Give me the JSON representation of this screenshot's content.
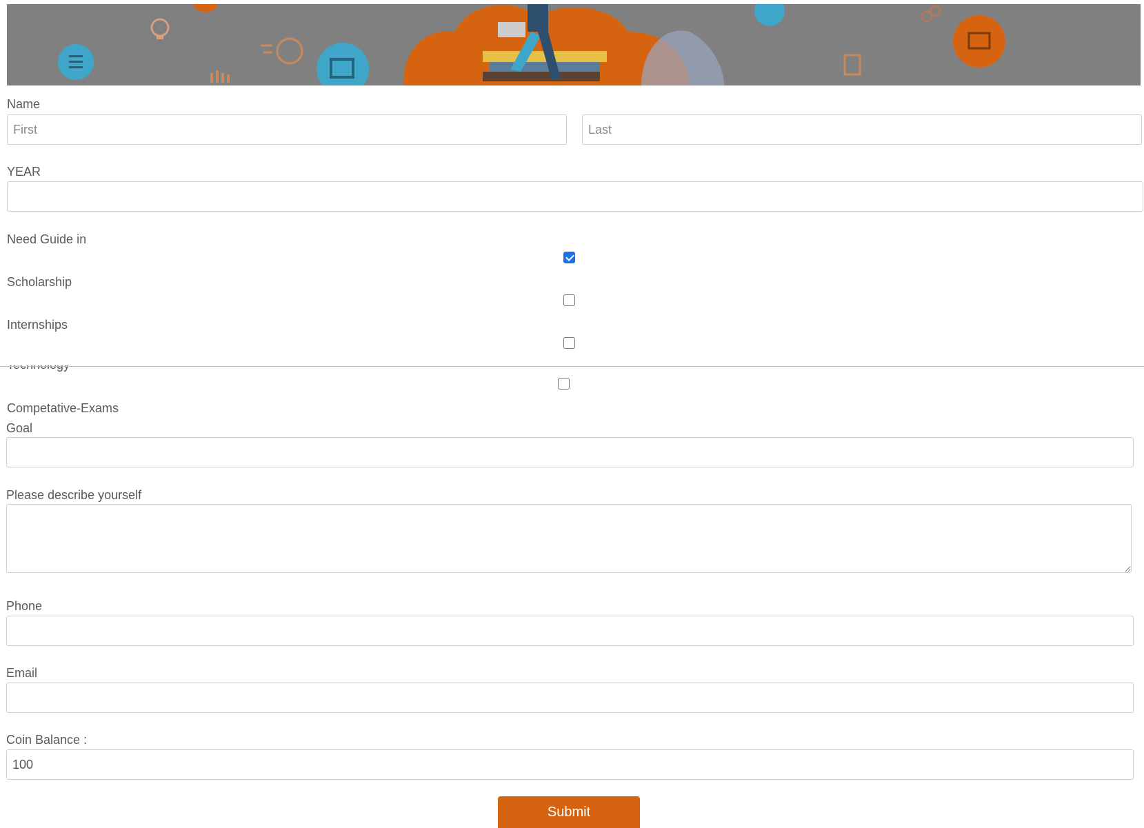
{
  "banner": {
    "icons": [
      "list-icon",
      "lightbulb-icon",
      "stopwatch-icon",
      "chart-icon",
      "board-icon",
      "laptop-student-illustration",
      "document-icon",
      "link-icon",
      "presentation-icon"
    ],
    "colors": {
      "overlay": "#808080",
      "orange": "#d6630f",
      "teal": "#3fa6c9"
    }
  },
  "form": {
    "name": {
      "label": "Name",
      "first_placeholder": "First",
      "last_placeholder": "Last"
    },
    "year": {
      "label": "YEAR",
      "value": ""
    },
    "guide": {
      "label": "Need Guide in",
      "options": [
        {
          "label": "Scholarship",
          "checked": true
        },
        {
          "label": "Internships",
          "checked": false
        },
        {
          "label": "Technology",
          "checked": false
        },
        {
          "label": "Competative-Exams",
          "checked": false
        }
      ]
    },
    "goal": {
      "label": "Goal",
      "value": ""
    },
    "describe": {
      "label": "Please describe yourself",
      "value": ""
    },
    "phone": {
      "label": "Phone",
      "value": ""
    },
    "email": {
      "label": "Email",
      "value": ""
    },
    "coins": {
      "label": "Coin Balance :",
      "value": "100"
    },
    "submit_label": "Submit"
  },
  "colors": {
    "accent": "#d6630f",
    "checkbox_checked": "#1a73e8",
    "label_text": "#5a5a5a",
    "field_border": "#cfcfcf"
  }
}
